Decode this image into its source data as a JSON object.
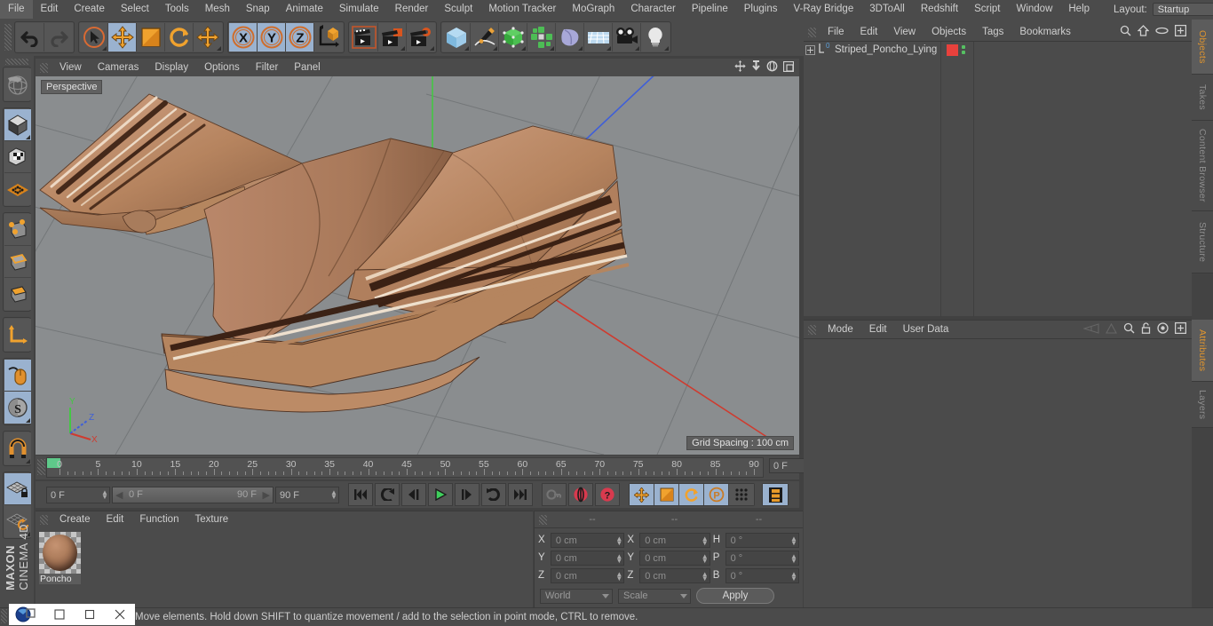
{
  "app": {
    "title": "CINEMA 4D",
    "brand_top": "MAXON",
    "brand_bottom": "CINEMA 4D"
  },
  "menubar": {
    "items": [
      "File",
      "Edit",
      "Create",
      "Select",
      "Tools",
      "Mesh",
      "Snap",
      "Animate",
      "Simulate",
      "Render",
      "Sculpt",
      "Motion Tracker",
      "MoGraph",
      "Character",
      "Pipeline",
      "Plugins",
      "V-Ray Bridge",
      "3DToAll",
      "Redshift",
      "Script",
      "Window",
      "Help"
    ],
    "layout_label": "Layout:",
    "layout_value": "Startup"
  },
  "toolbar": {
    "groups": [
      {
        "name": "undo-redo",
        "buttons": [
          {
            "icon": "undo-icon",
            "label": "Undo",
            "state": "normal"
          },
          {
            "icon": "redo-icon",
            "label": "Redo",
            "state": "disabled"
          }
        ]
      },
      {
        "name": "selection-transform",
        "buttons": [
          {
            "icon": "live-selection-icon",
            "label": "Live Selection",
            "state": "normal"
          },
          {
            "icon": "move-icon",
            "label": "Move",
            "state": "active"
          },
          {
            "icon": "scale-icon",
            "label": "Scale",
            "state": "normal"
          },
          {
            "icon": "rotate-icon",
            "label": "Rotate",
            "state": "normal"
          },
          {
            "icon": "move-axis-icon",
            "label": "Move Tool",
            "state": "normal"
          }
        ]
      },
      {
        "name": "axis-locks",
        "buttons": [
          {
            "icon": "x-axis-icon",
            "label": "X Axis",
            "state": "active"
          },
          {
            "icon": "y-axis-icon",
            "label": "Y Axis",
            "state": "active"
          },
          {
            "icon": "z-axis-icon",
            "label": "Z Axis",
            "state": "active"
          },
          {
            "icon": "world-coordinate-icon",
            "label": "World/Object Coordinate",
            "state": "normal"
          }
        ]
      },
      {
        "name": "render",
        "buttons": [
          {
            "icon": "render-view-icon",
            "label": "Render View",
            "state": "normal"
          },
          {
            "icon": "render-to-picture-viewer-icon",
            "label": "Render to Picture Viewer",
            "state": "normal"
          },
          {
            "icon": "render-settings-icon",
            "label": "Edit Render Settings",
            "state": "normal"
          }
        ]
      },
      {
        "name": "create-objects",
        "buttons": [
          {
            "icon": "cube-primitive-icon",
            "label": "Add Cube Object",
            "state": "normal"
          },
          {
            "icon": "spline-pen-icon",
            "label": "Spline Pen",
            "state": "normal"
          },
          {
            "icon": "nurbs-icon",
            "label": "Add HyperNURBS",
            "state": "normal"
          },
          {
            "icon": "array-icon",
            "label": "Add Array Object",
            "state": "normal"
          },
          {
            "icon": "bend-deformer-icon",
            "label": "Add Bend Object",
            "state": "normal"
          },
          {
            "icon": "floor-environment-icon",
            "label": "Add Floor Object",
            "state": "normal"
          },
          {
            "icon": "camera-icon",
            "label": "Add Camera Object",
            "state": "normal"
          },
          {
            "icon": "light-icon",
            "label": "Add Light Object",
            "state": "normal"
          }
        ]
      }
    ]
  },
  "left_toolbar": {
    "groups": [
      {
        "buttons": [
          {
            "icon": "globe-render-region-icon",
            "label": "Render Region",
            "state": "normal"
          }
        ]
      },
      {
        "buttons": [
          {
            "icon": "make-editable-icon",
            "label": "Make Editable",
            "state": "active"
          },
          {
            "icon": "model-mode-icon",
            "label": "Model Mode",
            "state": "normal"
          },
          {
            "icon": "texture-mode-icon",
            "label": "Texture Mode",
            "state": "normal"
          }
        ]
      },
      {
        "buttons": [
          {
            "icon": "point-mode-icon",
            "label": "Points",
            "state": "normal"
          },
          {
            "icon": "edge-mode-icon",
            "label": "Edges",
            "state": "normal"
          },
          {
            "icon": "polygon-mode-icon",
            "label": "Polygons",
            "state": "normal"
          }
        ]
      },
      {
        "buttons": [
          {
            "icon": "axis-modify-icon",
            "label": "Enable Axis Modification",
            "state": "normal"
          }
        ]
      },
      {
        "buttons": [
          {
            "icon": "viewport-solo-mouse-icon",
            "label": "Viewport Solo Single",
            "state": "active"
          },
          {
            "icon": "soft-selection-icon",
            "label": "Soft Selection",
            "state": "active"
          }
        ]
      },
      {
        "buttons": [
          {
            "icon": "magnet-icon",
            "label": "Magnet",
            "state": "normal"
          }
        ]
      },
      {
        "buttons": [
          {
            "icon": "workplane-lock-icon",
            "label": "Lock Workplane",
            "state": "active"
          },
          {
            "icon": "workplane-rotate-icon",
            "label": "Planar Workplane",
            "state": "normal"
          }
        ]
      }
    ]
  },
  "viewport": {
    "menu": [
      "View",
      "Cameras",
      "Display",
      "Options",
      "Filter",
      "Panel"
    ],
    "icons": [
      "pan-icon",
      "zoom-icon",
      "rotate-view-icon",
      "maximize-viewport-icon"
    ],
    "camera_label": "Perspective",
    "grid_spacing": "Grid Spacing : 100 cm",
    "axis_gizmo": {
      "x": "X",
      "y": "Y",
      "z": "Z",
      "x_color": "#d94a3a",
      "y_color": "#4ec94e",
      "z_color": "#4a6fe0"
    },
    "background_color": "#8a8d8f",
    "object_colors": {
      "light": "#c9a184",
      "mid": "#ab7a5a",
      "dark": "#4a2f20",
      "highlight": "#e4cbb5"
    }
  },
  "timeline": {
    "ticks": [
      0,
      5,
      10,
      15,
      20,
      25,
      30,
      35,
      40,
      45,
      50,
      55,
      60,
      65,
      70,
      75,
      80,
      85,
      90
    ],
    "current_frame_field": "0 F",
    "start_frame": "0 F",
    "range_start": "0 F",
    "range_end": "90 F",
    "end_frame": "90 F",
    "marker_color": "#5ec98a"
  },
  "anim_toolbar": {
    "transport": [
      {
        "icon": "go-to-start-icon",
        "label": "Go to Start"
      },
      {
        "icon": "play-backwards-icon",
        "label": "Play Backwards"
      },
      {
        "icon": "previous-frame-icon",
        "label": "Go to Previous Frame"
      },
      {
        "icon": "play-forward-icon",
        "label": "Play Forwards"
      },
      {
        "icon": "next-frame-icon",
        "label": "Go to Next Frame"
      },
      {
        "icon": "play-loop-icon",
        "label": "Loop"
      },
      {
        "icon": "go-to-end-icon",
        "label": "Go to End"
      }
    ],
    "record": [
      {
        "icon": "autokey-key-icon",
        "label": "Record Active Objects",
        "state": "disabled"
      },
      {
        "icon": "autokeying-icon",
        "label": "Autokeying",
        "state": "normal"
      },
      {
        "icon": "keyframe-selection-icon",
        "label": "Keyframe Selection",
        "state": "normal"
      }
    ],
    "pla": [
      {
        "icon": "record-position-icon",
        "label": "Position",
        "state": "active"
      },
      {
        "icon": "record-scale-icon",
        "label": "Scale",
        "state": "active"
      },
      {
        "icon": "record-rotation-icon",
        "label": "Rotation",
        "state": "active"
      },
      {
        "icon": "record-pla-icon",
        "label": "Parameter / PLA",
        "state": "active"
      },
      {
        "icon": "point-level-animation-icon",
        "label": "Point Level Animation",
        "state": "active"
      }
    ],
    "timeline_toggle": {
      "icon": "timeline-filmstrip-icon",
      "label": "Timeline",
      "state": "active"
    }
  },
  "material_manager": {
    "menu": [
      "Create",
      "Edit",
      "Function",
      "Texture"
    ],
    "materials": [
      {
        "name": "Poncho",
        "color": "#b07f5e"
      }
    ]
  },
  "coordinates": {
    "header_dashes": [
      "--",
      "--",
      "--"
    ],
    "position": {
      "label_x": "X",
      "label_y": "Y",
      "label_z": "Z",
      "x": "0 cm",
      "y": "0 cm",
      "z": "0 cm"
    },
    "size": {
      "label_x": "X",
      "label_y": "Y",
      "label_z": "Z",
      "x": "0 cm",
      "y": "0 cm",
      "z": "0 cm"
    },
    "rotation": {
      "label_h": "H",
      "label_p": "P",
      "label_b": "B",
      "h": "0 °",
      "p": "0 °",
      "b": "0 °"
    },
    "coord_system": "World",
    "mode": "Scale",
    "apply": "Apply"
  },
  "object_manager": {
    "menu": [
      "File",
      "Edit",
      "View",
      "Objects",
      "Tags",
      "Bookmarks"
    ],
    "icons": [
      "search-icon",
      "home-icon",
      "ellipse-icon",
      "add-layer-icon"
    ],
    "objects": [
      {
        "name": "Striped_Poncho_Lying",
        "type_icon": "polygon-object-icon",
        "tag_color": "#e8413c",
        "visibility_dots": 2
      }
    ]
  },
  "attribute_manager": {
    "menu": [
      "Mode",
      "Edit",
      "User Data"
    ],
    "icons": [
      "back-nav-icon",
      "forward-nav-icon",
      "search-icon",
      "lock-icon",
      "target-icon",
      "add-icon"
    ]
  },
  "edge_tabs": {
    "top": [
      {
        "label": "Objects",
        "active": true
      },
      {
        "label": "Takes",
        "active": false
      },
      {
        "label": "Content Browser",
        "active": false
      },
      {
        "label": "Structure",
        "active": false
      }
    ],
    "bottom": [
      {
        "label": "Attributes",
        "active": true
      },
      {
        "label": "Layers",
        "active": false
      }
    ]
  },
  "status_bar": {
    "message": "Move elements. Hold down SHIFT to quantize movement / add to the selection in point mode, CTRL to remove."
  },
  "taskbar": {
    "app_icon": "cinema4d-icon",
    "buttons": [
      {
        "icon": "minimize-icon",
        "label": "Minimize"
      },
      {
        "icon": "maximize-icon",
        "label": "Maximize"
      },
      {
        "icon": "close-icon",
        "label": "Close"
      }
    ]
  }
}
